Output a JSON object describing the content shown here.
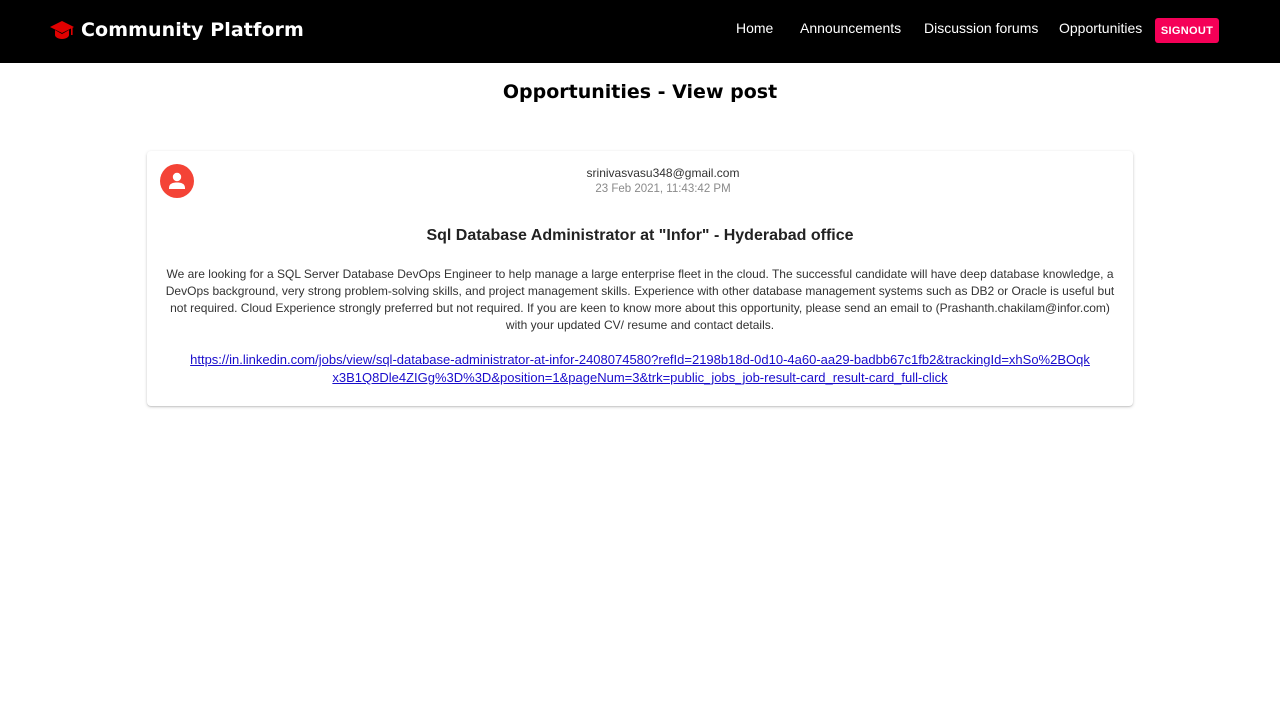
{
  "header": {
    "brand_icon": "graduation-cap-icon",
    "brand_title": "Community Platform",
    "nav": {
      "home": "Home",
      "announcements": "Announcements",
      "discussion_forums": "Discussion forums",
      "opportunities": "Opportunities"
    },
    "signout_label": "SIGNOUT"
  },
  "page": {
    "title": "Opportunities - View post"
  },
  "post": {
    "avatar_icon": "account-circle-icon",
    "author_email": "srinivasvasu348@gmail.com",
    "date": "23 Feb 2021, 11:43:42 PM",
    "title": "Sql Database Administrator at \"Infor\" - Hyderabad office",
    "body": "We are looking for a SQL Server Database DevOps Engineer to help manage a large enterprise fleet in the cloud. The successful candidate will have deep database knowledge, a DevOps background, very strong problem-solving skills, and project management skills. Experience with other database management systems such as DB2 or Oracle is useful but not required. Cloud Experience strongly preferred but not required. If you are keen to know more about this opportunity, please send an email to (Prashanth.chakilam@infor.com) with your updated CV/ resume and contact details.",
    "link": "https://in.linkedin.com/jobs/view/sql-database-administrator-at-infor-2408074580?refId=2198b18d-0d10-4a60-aa29-badbb67c1fb2&trackingId=xhSo%2BOqkx3B1Q8Dle4ZIGg%3D%3D&position=1&pageNum=3&trk=public_jobs_job-result-card_result-card_full-click"
  },
  "colors": {
    "navbar_bg": "#000000",
    "brand_icon": "#e00000",
    "signout_bg": "#f50057",
    "avatar_bg": "#f44336",
    "link": "#1a0dcc"
  }
}
